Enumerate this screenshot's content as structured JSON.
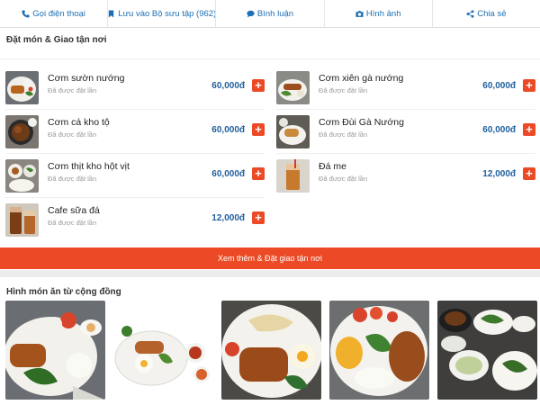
{
  "actions": [
    {
      "label": "Gọi điện thoại",
      "icon": "phone-icon"
    },
    {
      "label": "Lưu vào Bộ sưu tập (962)",
      "icon": "bookmark-icon"
    },
    {
      "label": "Bình luận",
      "icon": "comment-icon"
    },
    {
      "label": "Hình ảnh",
      "icon": "camera-icon"
    },
    {
      "label": "Chia sẻ",
      "icon": "share-icon"
    }
  ],
  "menu": {
    "title": "Đặt món & Giao tận nơi",
    "items": [
      {
        "name": "Cơm sườn nướng",
        "ordered": "Đã được đặt lần",
        "price": "60,000đ",
        "add": "+"
      },
      {
        "name": "Cơm xiên gà nướng",
        "ordered": "Đã được đặt lần",
        "price": "60,000đ",
        "add": "+"
      },
      {
        "name": "Cơm cá kho tộ",
        "ordered": "Đã được đặt lần",
        "price": "60,000đ",
        "add": "+"
      },
      {
        "name": "Cơm Đùi Gà Nướng",
        "ordered": "Đã được đặt lần",
        "price": "60,000đ",
        "add": "+"
      },
      {
        "name": "Cơm thịt kho hột vịt",
        "ordered": "Đã được đặt lần",
        "price": "60,000đ",
        "add": "+"
      },
      {
        "name": "Đá me",
        "ordered": "Đã được đặt lần",
        "price": "12,000đ",
        "add": "+"
      },
      {
        "name": "Cafe sữa đá",
        "ordered": "Đã được đặt lần",
        "price": "12,000đ",
        "add": "+"
      }
    ],
    "cta": "Xem thêm & Đặt giao tận nơi"
  },
  "community": {
    "title": "Hình món ăn từ cộng đồng"
  },
  "colors": {
    "accent": "#ec4a26",
    "link": "#1c6fb4",
    "price": "#1f5f9e"
  }
}
